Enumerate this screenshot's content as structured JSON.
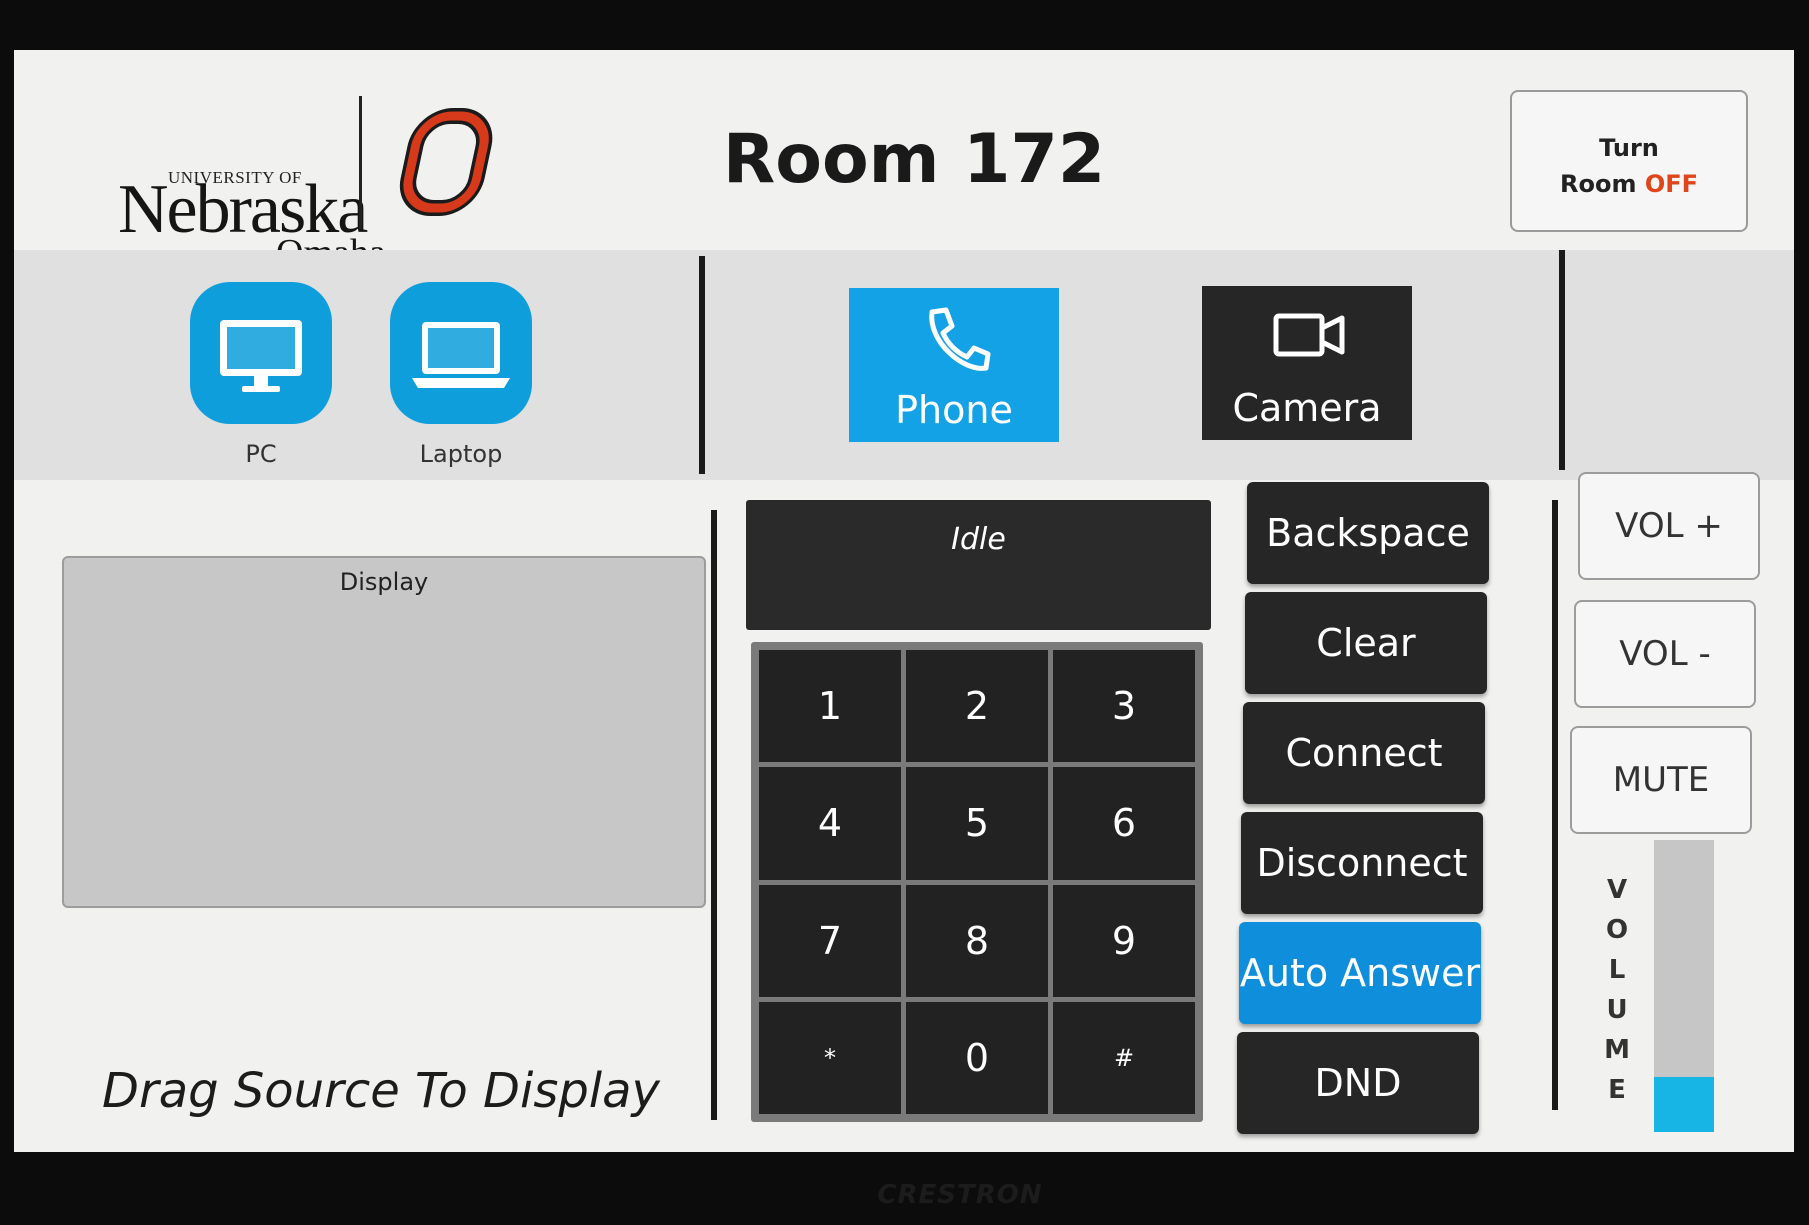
{
  "header": {
    "logo": {
      "university": "UNIVERSITY OF",
      "name": "Nebraska",
      "campus": "Omaha"
    },
    "room_title": "Room 172",
    "room_off": {
      "line1": "Turn",
      "line2_a": "Room ",
      "line2_b": "OFF"
    }
  },
  "sources": [
    {
      "label": "PC",
      "icon": "monitor-icon"
    },
    {
      "label": "Laptop",
      "icon": "laptop-icon"
    }
  ],
  "modes": [
    {
      "label": "Phone",
      "icon": "phone-icon",
      "active": true
    },
    {
      "label": "Camera",
      "icon": "video-camera-icon",
      "active": false
    }
  ],
  "display": {
    "label": "Display",
    "hint": "Drag Source To Display"
  },
  "phone": {
    "status": "Idle",
    "keys": [
      "1",
      "2",
      "3",
      "4",
      "5",
      "6",
      "7",
      "8",
      "9",
      "*",
      "0",
      "#"
    ],
    "commands": {
      "backspace": "Backspace",
      "clear": "Clear",
      "connect": "Connect",
      "disconnect": "Disconnect",
      "auto_answer": "Auto Answer",
      "dnd": "DND"
    }
  },
  "volume": {
    "up": "VOL +",
    "down": "VOL -",
    "mute": "MUTE",
    "label_letters": [
      "V",
      "O",
      "L",
      "U",
      "M",
      "E"
    ],
    "level_fraction": 0.19
  },
  "device_brand": "CRESTRON",
  "colors": {
    "accent": "#0e9edb",
    "off": "#e0451c",
    "dark_button": "#262626"
  }
}
